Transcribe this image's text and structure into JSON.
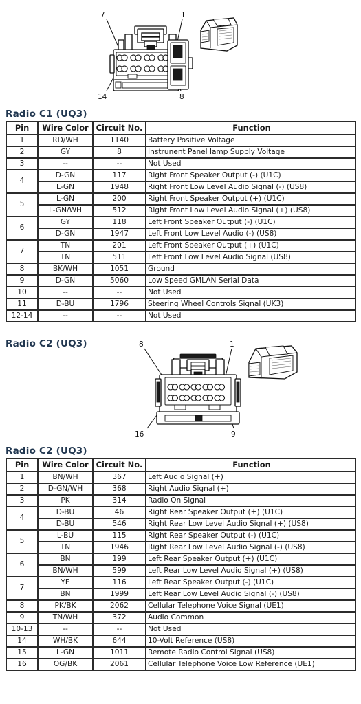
{
  "page": {
    "background": "#ffffff",
    "heading_color": "#20364f"
  },
  "diagram_c1": {
    "name": "Radio C1 (UQ3) connector face view",
    "callouts": [
      "7",
      "1",
      "14",
      "8"
    ],
    "cavity_rows": 2,
    "cavities_per_row": 6
  },
  "diagram_c2": {
    "title": "Radio C2 (UQ3)",
    "name": "Radio C2 (UQ3) connector face view",
    "callouts": [
      "8",
      "1",
      "16",
      "9"
    ],
    "cavity_rows": 2,
    "cavities_per_row": 8
  },
  "table_c1": {
    "title": "Radio C1 (UQ3)",
    "columns": [
      "Pin",
      "Wire Color",
      "Circuit No.",
      "Function"
    ],
    "rows": [
      {
        "pin": "1",
        "span": 1,
        "lines": [
          {
            "wire": "RD/WH",
            "circuit": "1140",
            "function": "Battery Positive Voltage"
          }
        ]
      },
      {
        "pin": "2",
        "span": 1,
        "lines": [
          {
            "wire": "GY",
            "circuit": "8",
            "function": "Instrunent Panel lamp Supply Voltage"
          }
        ]
      },
      {
        "pin": "3",
        "span": 1,
        "lines": [
          {
            "wire": "--",
            "circuit": "--",
            "function": "Not Used"
          }
        ]
      },
      {
        "pin": "4",
        "span": 2,
        "lines": [
          {
            "wire": "D-GN",
            "circuit": "117",
            "function": "Right Front Speaker Output (-) (U1C)"
          },
          {
            "wire": "L-GN",
            "circuit": "1948",
            "function": "Right Front Low Level Audio Signal (-) (US8)"
          }
        ]
      },
      {
        "pin": "5",
        "span": 2,
        "lines": [
          {
            "wire": "L-GN",
            "circuit": "200",
            "function": "Right Front Speaker Output (+) (U1C)"
          },
          {
            "wire": "L-GN/WH",
            "circuit": "512",
            "function": "Right Front Low Level Audio Signal (+) (US8)"
          }
        ]
      },
      {
        "pin": "6",
        "span": 2,
        "lines": [
          {
            "wire": "GY",
            "circuit": "118",
            "function": "Left Front Speaker Output (-) (U1C)"
          },
          {
            "wire": "D-GN",
            "circuit": "1947",
            "function": "Left Front Low Level Audio (-) (US8)"
          }
        ]
      },
      {
        "pin": "7",
        "span": 2,
        "lines": [
          {
            "wire": "TN",
            "circuit": "201",
            "function": "Left Front Speaker Output (+) (U1C)"
          },
          {
            "wire": "TN",
            "circuit": "511",
            "function": "Left Front Low Level Audio Signal (US8)"
          }
        ]
      },
      {
        "pin": "8",
        "span": 1,
        "lines": [
          {
            "wire": "BK/WH",
            "circuit": "1051",
            "function": "Ground"
          }
        ]
      },
      {
        "pin": "9",
        "span": 1,
        "lines": [
          {
            "wire": "D-GN",
            "circuit": "5060",
            "function": "Low Speed GMLAN Serial Data"
          }
        ]
      },
      {
        "pin": "10",
        "span": 1,
        "lines": [
          {
            "wire": "--",
            "circuit": "--",
            "function": "Not Used"
          }
        ]
      },
      {
        "pin": "11",
        "span": 1,
        "lines": [
          {
            "wire": "D-BU",
            "circuit": "1796",
            "function": "Steering Wheel Controls Signal (UK3)"
          }
        ]
      },
      {
        "pin": "12-14",
        "span": 1,
        "lines": [
          {
            "wire": "--",
            "circuit": "--",
            "function": "Not Used"
          }
        ]
      }
    ]
  },
  "table_c2": {
    "title": "Radio C2 (UQ3)",
    "columns": [
      "Pin",
      "Wire Color",
      "Circuit No.",
      "Function"
    ],
    "rows": [
      {
        "pin": "1",
        "span": 1,
        "lines": [
          {
            "wire": "BN/WH",
            "circuit": "367",
            "function": "Left Audio Signal (+)"
          }
        ]
      },
      {
        "pin": "2",
        "span": 1,
        "lines": [
          {
            "wire": "D-GN/WH",
            "circuit": "368",
            "function": "Right Audio Signal (+)"
          }
        ]
      },
      {
        "pin": "3",
        "span": 1,
        "lines": [
          {
            "wire": "PK",
            "circuit": "314",
            "function": "Radio On Signal"
          }
        ]
      },
      {
        "pin": "4",
        "span": 2,
        "lines": [
          {
            "wire": "D-BU",
            "circuit": "46",
            "function": "Right Rear Speaker Output (+) (U1C)"
          },
          {
            "wire": "D-BU",
            "circuit": "546",
            "function": "Right Rear Low Level Audio Signal (+) (US8)"
          }
        ]
      },
      {
        "pin": "5",
        "span": 2,
        "lines": [
          {
            "wire": "L-BU",
            "circuit": "115",
            "function": "Right Rear Speaker Output (-) (U1C)"
          },
          {
            "wire": "TN",
            "circuit": "1946",
            "function": "Right Rear Low Level Audio Signal (-) (US8)"
          }
        ]
      },
      {
        "pin": "6",
        "span": 2,
        "lines": [
          {
            "wire": "BN",
            "circuit": "199",
            "function": "Left Rear Speaker Output (+) (U1C)"
          },
          {
            "wire": "BN/WH",
            "circuit": "599",
            "function": "Left Rear Low Level Audio Signal (+) (US8)"
          }
        ]
      },
      {
        "pin": "7",
        "span": 2,
        "lines": [
          {
            "wire": "YE",
            "circuit": "116",
            "function": "Left Rear Speaker Output (-) (U1C)"
          },
          {
            "wire": "BN",
            "circuit": "1999",
            "function": "Left Rear Low Level Audio Signal (-) (US8)"
          }
        ]
      },
      {
        "pin": "8",
        "span": 1,
        "lines": [
          {
            "wire": "PK/BK",
            "circuit": "2062",
            "function": "Cellular Telephone Voice Signal (UE1)"
          }
        ]
      },
      {
        "pin": "9",
        "span": 1,
        "lines": [
          {
            "wire": "TN/WH",
            "circuit": "372",
            "function": "Audio Common"
          }
        ]
      },
      {
        "pin": "10-13",
        "span": 1,
        "lines": [
          {
            "wire": "--",
            "circuit": "--",
            "function": "Not Used"
          }
        ]
      },
      {
        "pin": "14",
        "span": 1,
        "lines": [
          {
            "wire": "WH/BK",
            "circuit": "644",
            "function": "10-Volt Reference (US8)"
          }
        ]
      },
      {
        "pin": "15",
        "span": 1,
        "lines": [
          {
            "wire": "L-GN",
            "circuit": "1011",
            "function": "Remote Radio Control Signal (US8)"
          }
        ]
      },
      {
        "pin": "16",
        "span": 1,
        "lines": [
          {
            "wire": "OG/BK",
            "circuit": "2061",
            "function": "Cellular Telephone Voice Low Reference (UE1)"
          }
        ]
      }
    ]
  }
}
